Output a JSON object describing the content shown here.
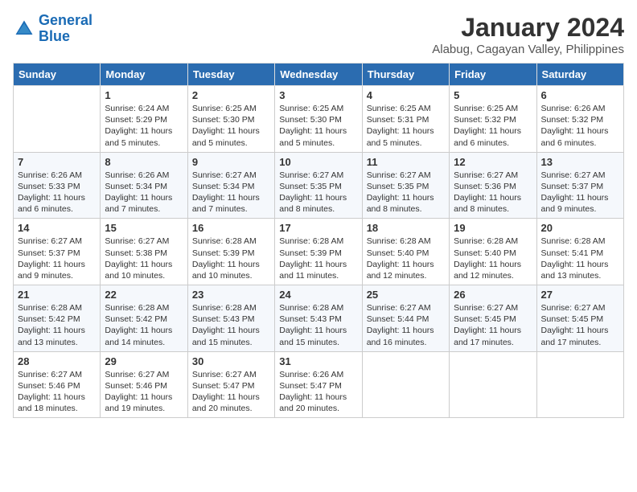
{
  "header": {
    "logo_line1": "General",
    "logo_line2": "Blue",
    "month": "January 2024",
    "location": "Alabug, Cagayan Valley, Philippines"
  },
  "weekdays": [
    "Sunday",
    "Monday",
    "Tuesday",
    "Wednesday",
    "Thursday",
    "Friday",
    "Saturday"
  ],
  "weeks": [
    [
      {
        "day": "",
        "empty": true
      },
      {
        "day": "1",
        "sunrise": "Sunrise: 6:24 AM",
        "sunset": "Sunset: 5:29 PM",
        "daylight": "Daylight: 11 hours and 5 minutes."
      },
      {
        "day": "2",
        "sunrise": "Sunrise: 6:25 AM",
        "sunset": "Sunset: 5:30 PM",
        "daylight": "Daylight: 11 hours and 5 minutes."
      },
      {
        "day": "3",
        "sunrise": "Sunrise: 6:25 AM",
        "sunset": "Sunset: 5:30 PM",
        "daylight": "Daylight: 11 hours and 5 minutes."
      },
      {
        "day": "4",
        "sunrise": "Sunrise: 6:25 AM",
        "sunset": "Sunset: 5:31 PM",
        "daylight": "Daylight: 11 hours and 5 minutes."
      },
      {
        "day": "5",
        "sunrise": "Sunrise: 6:25 AM",
        "sunset": "Sunset: 5:32 PM",
        "daylight": "Daylight: 11 hours and 6 minutes."
      },
      {
        "day": "6",
        "sunrise": "Sunrise: 6:26 AM",
        "sunset": "Sunset: 5:32 PM",
        "daylight": "Daylight: 11 hours and 6 minutes."
      }
    ],
    [
      {
        "day": "7",
        "sunrise": "Sunrise: 6:26 AM",
        "sunset": "Sunset: 5:33 PM",
        "daylight": "Daylight: 11 hours and 6 minutes."
      },
      {
        "day": "8",
        "sunrise": "Sunrise: 6:26 AM",
        "sunset": "Sunset: 5:34 PM",
        "daylight": "Daylight: 11 hours and 7 minutes."
      },
      {
        "day": "9",
        "sunrise": "Sunrise: 6:27 AM",
        "sunset": "Sunset: 5:34 PM",
        "daylight": "Daylight: 11 hours and 7 minutes."
      },
      {
        "day": "10",
        "sunrise": "Sunrise: 6:27 AM",
        "sunset": "Sunset: 5:35 PM",
        "daylight": "Daylight: 11 hours and 8 minutes."
      },
      {
        "day": "11",
        "sunrise": "Sunrise: 6:27 AM",
        "sunset": "Sunset: 5:35 PM",
        "daylight": "Daylight: 11 hours and 8 minutes."
      },
      {
        "day": "12",
        "sunrise": "Sunrise: 6:27 AM",
        "sunset": "Sunset: 5:36 PM",
        "daylight": "Daylight: 11 hours and 8 minutes."
      },
      {
        "day": "13",
        "sunrise": "Sunrise: 6:27 AM",
        "sunset": "Sunset: 5:37 PM",
        "daylight": "Daylight: 11 hours and 9 minutes."
      }
    ],
    [
      {
        "day": "14",
        "sunrise": "Sunrise: 6:27 AM",
        "sunset": "Sunset: 5:37 PM",
        "daylight": "Daylight: 11 hours and 9 minutes."
      },
      {
        "day": "15",
        "sunrise": "Sunrise: 6:27 AM",
        "sunset": "Sunset: 5:38 PM",
        "daylight": "Daylight: 11 hours and 10 minutes."
      },
      {
        "day": "16",
        "sunrise": "Sunrise: 6:28 AM",
        "sunset": "Sunset: 5:39 PM",
        "daylight": "Daylight: 11 hours and 10 minutes."
      },
      {
        "day": "17",
        "sunrise": "Sunrise: 6:28 AM",
        "sunset": "Sunset: 5:39 PM",
        "daylight": "Daylight: 11 hours and 11 minutes."
      },
      {
        "day": "18",
        "sunrise": "Sunrise: 6:28 AM",
        "sunset": "Sunset: 5:40 PM",
        "daylight": "Daylight: 11 hours and 12 minutes."
      },
      {
        "day": "19",
        "sunrise": "Sunrise: 6:28 AM",
        "sunset": "Sunset: 5:40 PM",
        "daylight": "Daylight: 11 hours and 12 minutes."
      },
      {
        "day": "20",
        "sunrise": "Sunrise: 6:28 AM",
        "sunset": "Sunset: 5:41 PM",
        "daylight": "Daylight: 11 hours and 13 minutes."
      }
    ],
    [
      {
        "day": "21",
        "sunrise": "Sunrise: 6:28 AM",
        "sunset": "Sunset: 5:42 PM",
        "daylight": "Daylight: 11 hours and 13 minutes."
      },
      {
        "day": "22",
        "sunrise": "Sunrise: 6:28 AM",
        "sunset": "Sunset: 5:42 PM",
        "daylight": "Daylight: 11 hours and 14 minutes."
      },
      {
        "day": "23",
        "sunrise": "Sunrise: 6:28 AM",
        "sunset": "Sunset: 5:43 PM",
        "daylight": "Daylight: 11 hours and 15 minutes."
      },
      {
        "day": "24",
        "sunrise": "Sunrise: 6:28 AM",
        "sunset": "Sunset: 5:43 PM",
        "daylight": "Daylight: 11 hours and 15 minutes."
      },
      {
        "day": "25",
        "sunrise": "Sunrise: 6:27 AM",
        "sunset": "Sunset: 5:44 PM",
        "daylight": "Daylight: 11 hours and 16 minutes."
      },
      {
        "day": "26",
        "sunrise": "Sunrise: 6:27 AM",
        "sunset": "Sunset: 5:45 PM",
        "daylight": "Daylight: 11 hours and 17 minutes."
      },
      {
        "day": "27",
        "sunrise": "Sunrise: 6:27 AM",
        "sunset": "Sunset: 5:45 PM",
        "daylight": "Daylight: 11 hours and 17 minutes."
      }
    ],
    [
      {
        "day": "28",
        "sunrise": "Sunrise: 6:27 AM",
        "sunset": "Sunset: 5:46 PM",
        "daylight": "Daylight: 11 hours and 18 minutes."
      },
      {
        "day": "29",
        "sunrise": "Sunrise: 6:27 AM",
        "sunset": "Sunset: 5:46 PM",
        "daylight": "Daylight: 11 hours and 19 minutes."
      },
      {
        "day": "30",
        "sunrise": "Sunrise: 6:27 AM",
        "sunset": "Sunset: 5:47 PM",
        "daylight": "Daylight: 11 hours and 20 minutes."
      },
      {
        "day": "31",
        "sunrise": "Sunrise: 6:26 AM",
        "sunset": "Sunset: 5:47 PM",
        "daylight": "Daylight: 11 hours and 20 minutes."
      },
      {
        "day": "",
        "empty": true
      },
      {
        "day": "",
        "empty": true
      },
      {
        "day": "",
        "empty": true
      }
    ]
  ]
}
